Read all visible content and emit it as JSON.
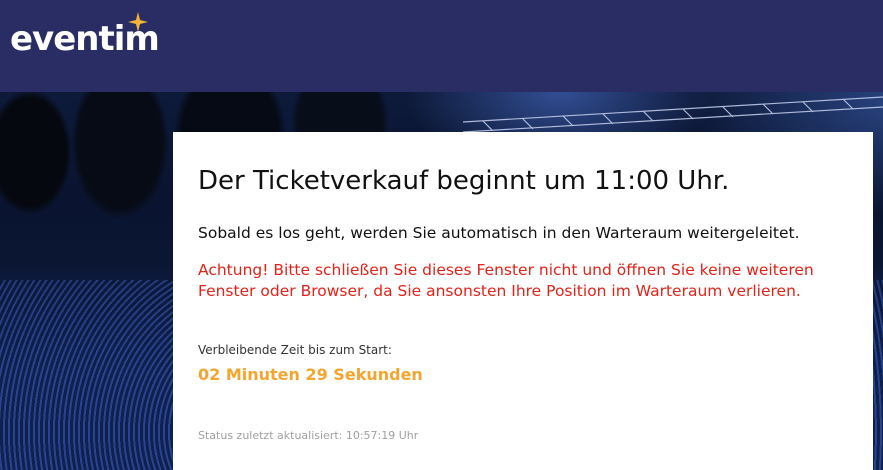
{
  "brand": {
    "logo_text": "eventim",
    "header_color": "#2a2d64",
    "star_color": "#f3b43a"
  },
  "notice": {
    "title": "Der Ticketverkauf beginnt um 11:00 Uhr.",
    "info": "Sobald es los geht, werden Sie automatisch in den Warteraum weitergeleitet.",
    "warning": "Achtung! Bitte schließen Sie dieses Fenster nicht und öffnen Sie keine weiteren Fenster oder Browser, da Sie ansonsten Ihre Position im Warteraum verlieren.",
    "warning_color": "#e2231a",
    "remaining_label": "Verbleibende Zeit bis zum Start:",
    "remaining_value": "02 Minuten 29 Sekunden",
    "remaining_color": "#f3a530",
    "status": "Status zuletzt aktualisiert: 10:57:19 Uhr"
  },
  "background": {
    "description_icon": "concert-crowd-image"
  }
}
